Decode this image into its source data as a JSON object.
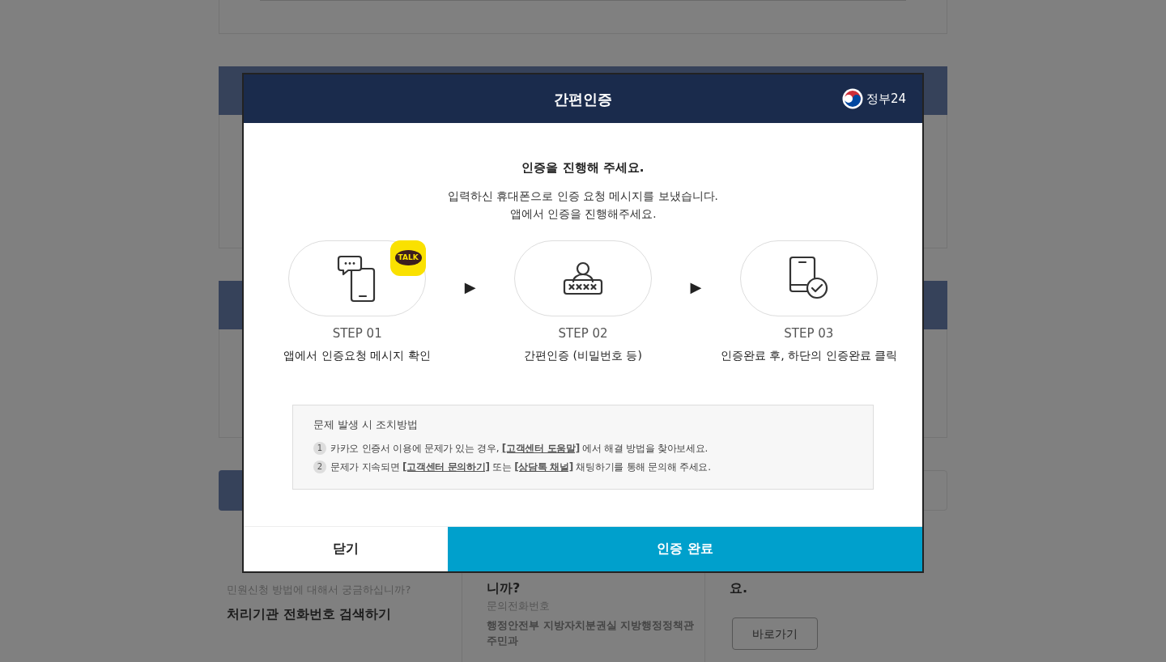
{
  "modal": {
    "title": "간편인증",
    "logo_text": "정부24",
    "heading": "인증을 진행해 주세요.",
    "message_lines": [
      "입력하신 휴대폰으로 인증 요청 메시지를 보냈습니다.",
      "앱에서 인증을 진행해주세요."
    ],
    "steps": [
      {
        "kind": "message",
        "step": "STEP 01",
        "description": "앱에서 인증요청 메시지 확인",
        "badge": "TALK"
      },
      {
        "kind": "password",
        "step": "STEP 02",
        "description": "간편인증 (비밀번호 등)"
      },
      {
        "kind": "complete",
        "step": "STEP 03",
        "description": "인증완료 후, 하단의 인증완료 클릭"
      }
    ],
    "step_separator": "▶",
    "help": {
      "title": "문제 발생 시 조치방법",
      "items": [
        {
          "number": "1",
          "parts": [
            {
              "kind": "text",
              "text": "카카오 인증서 이용에 문제가 있는 경우, "
            },
            {
              "kind": "link",
              "text": "[고객센터 도움말]"
            },
            {
              "kind": "text",
              "text": " 에서 해결 방법을 찾아보세요."
            }
          ]
        },
        {
          "number": "2",
          "parts": [
            {
              "kind": "text",
              "text": "문제가 지속되면 "
            },
            {
              "kind": "link",
              "text": "[고객센터 문의하기]"
            },
            {
              "kind": "text",
              "text": " 또는 "
            },
            {
              "kind": "link",
              "text": "[상담톡 채널]"
            },
            {
              "kind": "text",
              "text": " 채팅하기를 통해 문의해 주세요."
            }
          ]
        }
      ]
    },
    "buttons": [
      {
        "kind": "secondary",
        "label": "닫기"
      },
      {
        "kind": "primary",
        "label": "인증 완료"
      }
    ]
  },
  "background": {
    "columns": [
      {
        "texts": [
          {
            "kind": "sub",
            "text": "민원신청 방법에 대해서 궁금하십니까?"
          },
          {
            "kind": "link",
            "text": "처리기관 전화번호 검색하기"
          }
        ]
      },
      {
        "texts": [
          {
            "kind": "heading",
            "text": "니까?"
          },
          {
            "kind": "sub",
            "text": "문의전화번호"
          },
          {
            "kind": "strong",
            "text": "행정안전부 지방자치분권실 지방행정정책관 주민과"
          }
        ]
      },
      {
        "texts": [
          {
            "kind": "heading",
            "text": "요."
          },
          {
            "kind": "button",
            "text": "바로가기"
          }
        ]
      }
    ]
  }
}
